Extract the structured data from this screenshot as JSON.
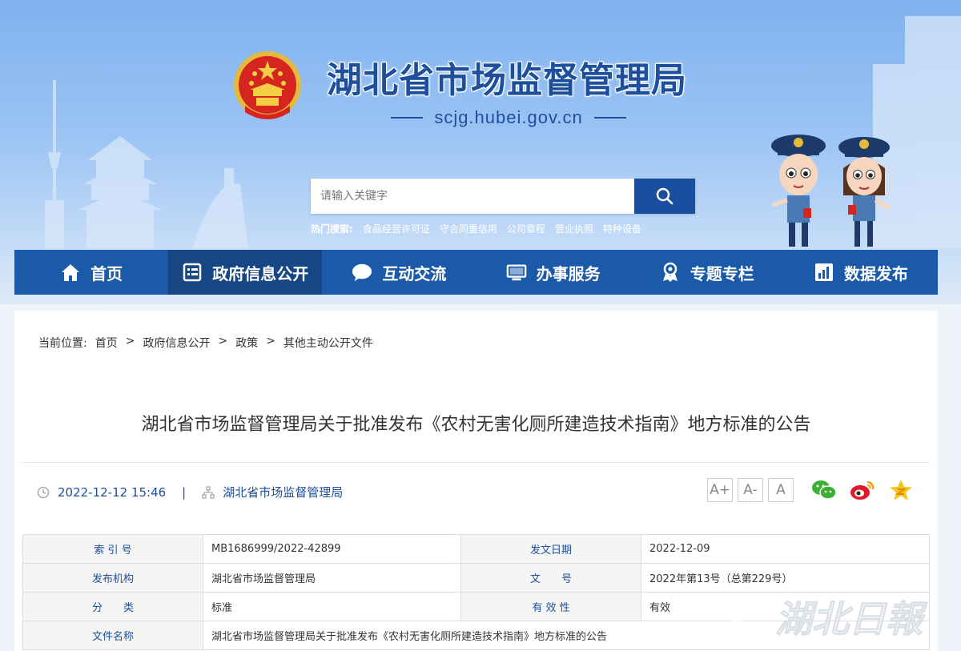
{
  "header": {
    "site_title": "湖北省市场监督管理局",
    "site_url": "scjg.hubei.gov.cn",
    "search": {
      "placeholder": "请输入关键字"
    },
    "hot_search": {
      "label": "热门搜索:",
      "items": [
        "食品经营许可证",
        "守合同重信用",
        "公司章程",
        "营业执照",
        "特种设备"
      ]
    }
  },
  "nav": {
    "items": [
      {
        "label": "首页",
        "icon": "home-icon"
      },
      {
        "label": "政府信息公开",
        "icon": "document-list-icon",
        "active": true
      },
      {
        "label": "互动交流",
        "icon": "chat-bubble-icon"
      },
      {
        "label": "办事服务",
        "icon": "monitor-icon"
      },
      {
        "label": "专题专栏",
        "icon": "badge-icon"
      },
      {
        "label": "数据发布",
        "icon": "bar-chart-icon"
      }
    ]
  },
  "breadcrumb": {
    "label": "当前位置:",
    "items": [
      "首页",
      "政府信息公开",
      "政策",
      "其他主动公开文件"
    ],
    "separator": ">"
  },
  "article": {
    "title": "湖北省市场监督管理局关于批准发布《农村无害化厕所建造技术指南》地方标准的公告",
    "datetime": "2022-12-12 15:46",
    "meta_separator": "|",
    "source": "湖北省市场监督管理局",
    "font_sizes": [
      "A+",
      "A-",
      "A"
    ]
  },
  "share": [
    "wechat-icon",
    "weibo-icon",
    "qzone-icon"
  ],
  "info_table": {
    "rows": [
      {
        "label1": "索 引 号",
        "value1": "MB1686999/2022-42899",
        "label2": "发文日期",
        "value2": "2022-12-09"
      },
      {
        "label1": "发布机构",
        "value1": "湖北省市场监督管理局",
        "label2": "文　　号",
        "value2": "2022年第13号（总第229号）"
      },
      {
        "label1": "分　　类",
        "value1": "标准",
        "label2": "有 效 性",
        "value2": "有效"
      }
    ],
    "file_label": "文件名称",
    "file_value": "湖北省市场监督管理局关于批准发布《农村无害化厕所建造技术指南》地方标准的公告"
  },
  "watermark": "湖北日报",
  "colors": {
    "nav_bg": "#1a5aa8",
    "nav_active": "#174684",
    "accent_text": "#1e4f9a",
    "title_blue": "#1d4f9c"
  }
}
